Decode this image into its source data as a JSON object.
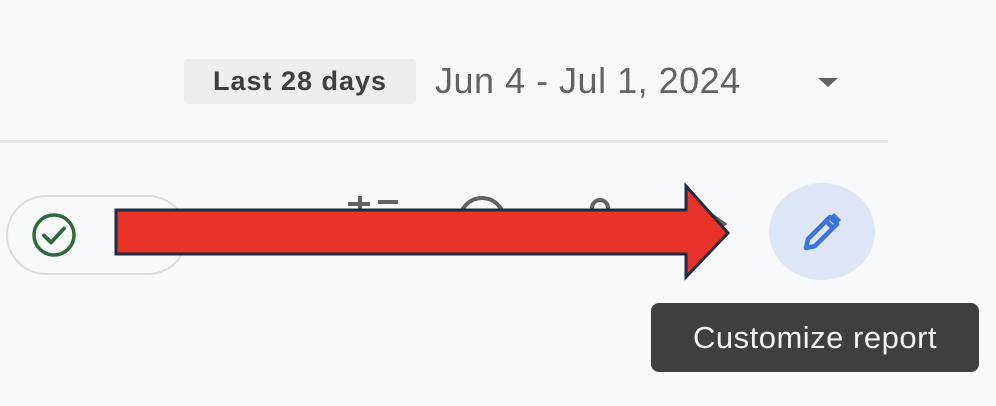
{
  "date_selector": {
    "preset_label": "Last 28 days",
    "range_text": "Jun 4 - Jul 1, 2024",
    "dropdown_icon": "caret-down-icon"
  },
  "toolbar": {
    "status_icon": "check-circle-icon",
    "status_color": "#2f6b3a",
    "edit_icon": "pencil-icon",
    "edit_button_color": "#dde6f6",
    "edit_icon_color": "#3b73e0"
  },
  "tooltip": {
    "text": "Customize report"
  },
  "annotation": {
    "arrow_icon": "red-arrow-icon",
    "arrow_color": "#e8322a"
  }
}
